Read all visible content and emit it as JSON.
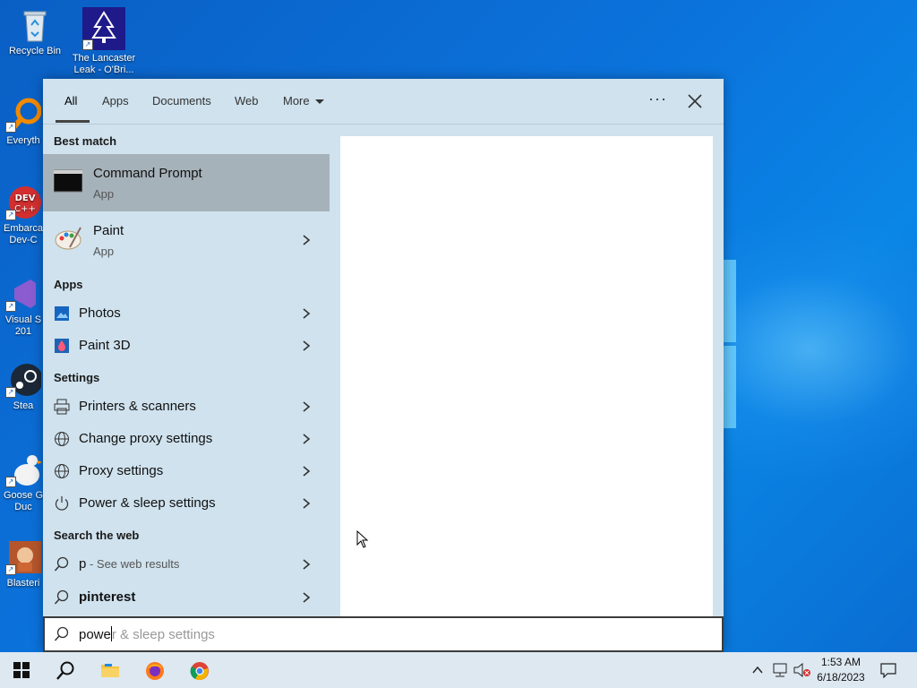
{
  "desktop": {
    "icons": [
      {
        "label": "Recycle Bin"
      },
      {
        "label": "The Lancaster Leak - O'Bri..."
      },
      {
        "label": "Everyth"
      },
      {
        "label": "Embarca Dev-C"
      },
      {
        "label": "Visual S 201"
      },
      {
        "label": "Stea"
      },
      {
        "label": "Goose G Duc"
      },
      {
        "label": "Blasteri"
      }
    ]
  },
  "search": {
    "tabs": [
      {
        "label": "All"
      },
      {
        "label": "Apps"
      },
      {
        "label": "Documents"
      },
      {
        "label": "Web"
      },
      {
        "label": "More"
      }
    ],
    "sections": {
      "best_match": "Best match",
      "apps": "Apps",
      "settings": "Settings",
      "web": "Search the web"
    },
    "best_match": [
      {
        "title": "Command Prompt",
        "sub": "App"
      },
      {
        "title": "Paint",
        "sub": "App"
      }
    ],
    "apps": [
      {
        "title": "Photos"
      },
      {
        "title": "Paint 3D"
      }
    ],
    "settings": [
      {
        "title": "Printers & scanners"
      },
      {
        "title": "Change proxy settings"
      },
      {
        "title": "Proxy settings"
      },
      {
        "title": "Power & sleep settings"
      }
    ],
    "web": [
      {
        "title": "p",
        "sub": " - See web results"
      },
      {
        "title": "pinterest"
      }
    ],
    "box": {
      "typed": "powe",
      "suggestion": "r & sleep settings"
    }
  },
  "taskbar": {
    "time": "1:53 AM",
    "date": "6/18/2023"
  },
  "colors": {
    "accent": "#0078d7",
    "panel": "#cfe2ee",
    "selected": "#a6b2ba"
  }
}
